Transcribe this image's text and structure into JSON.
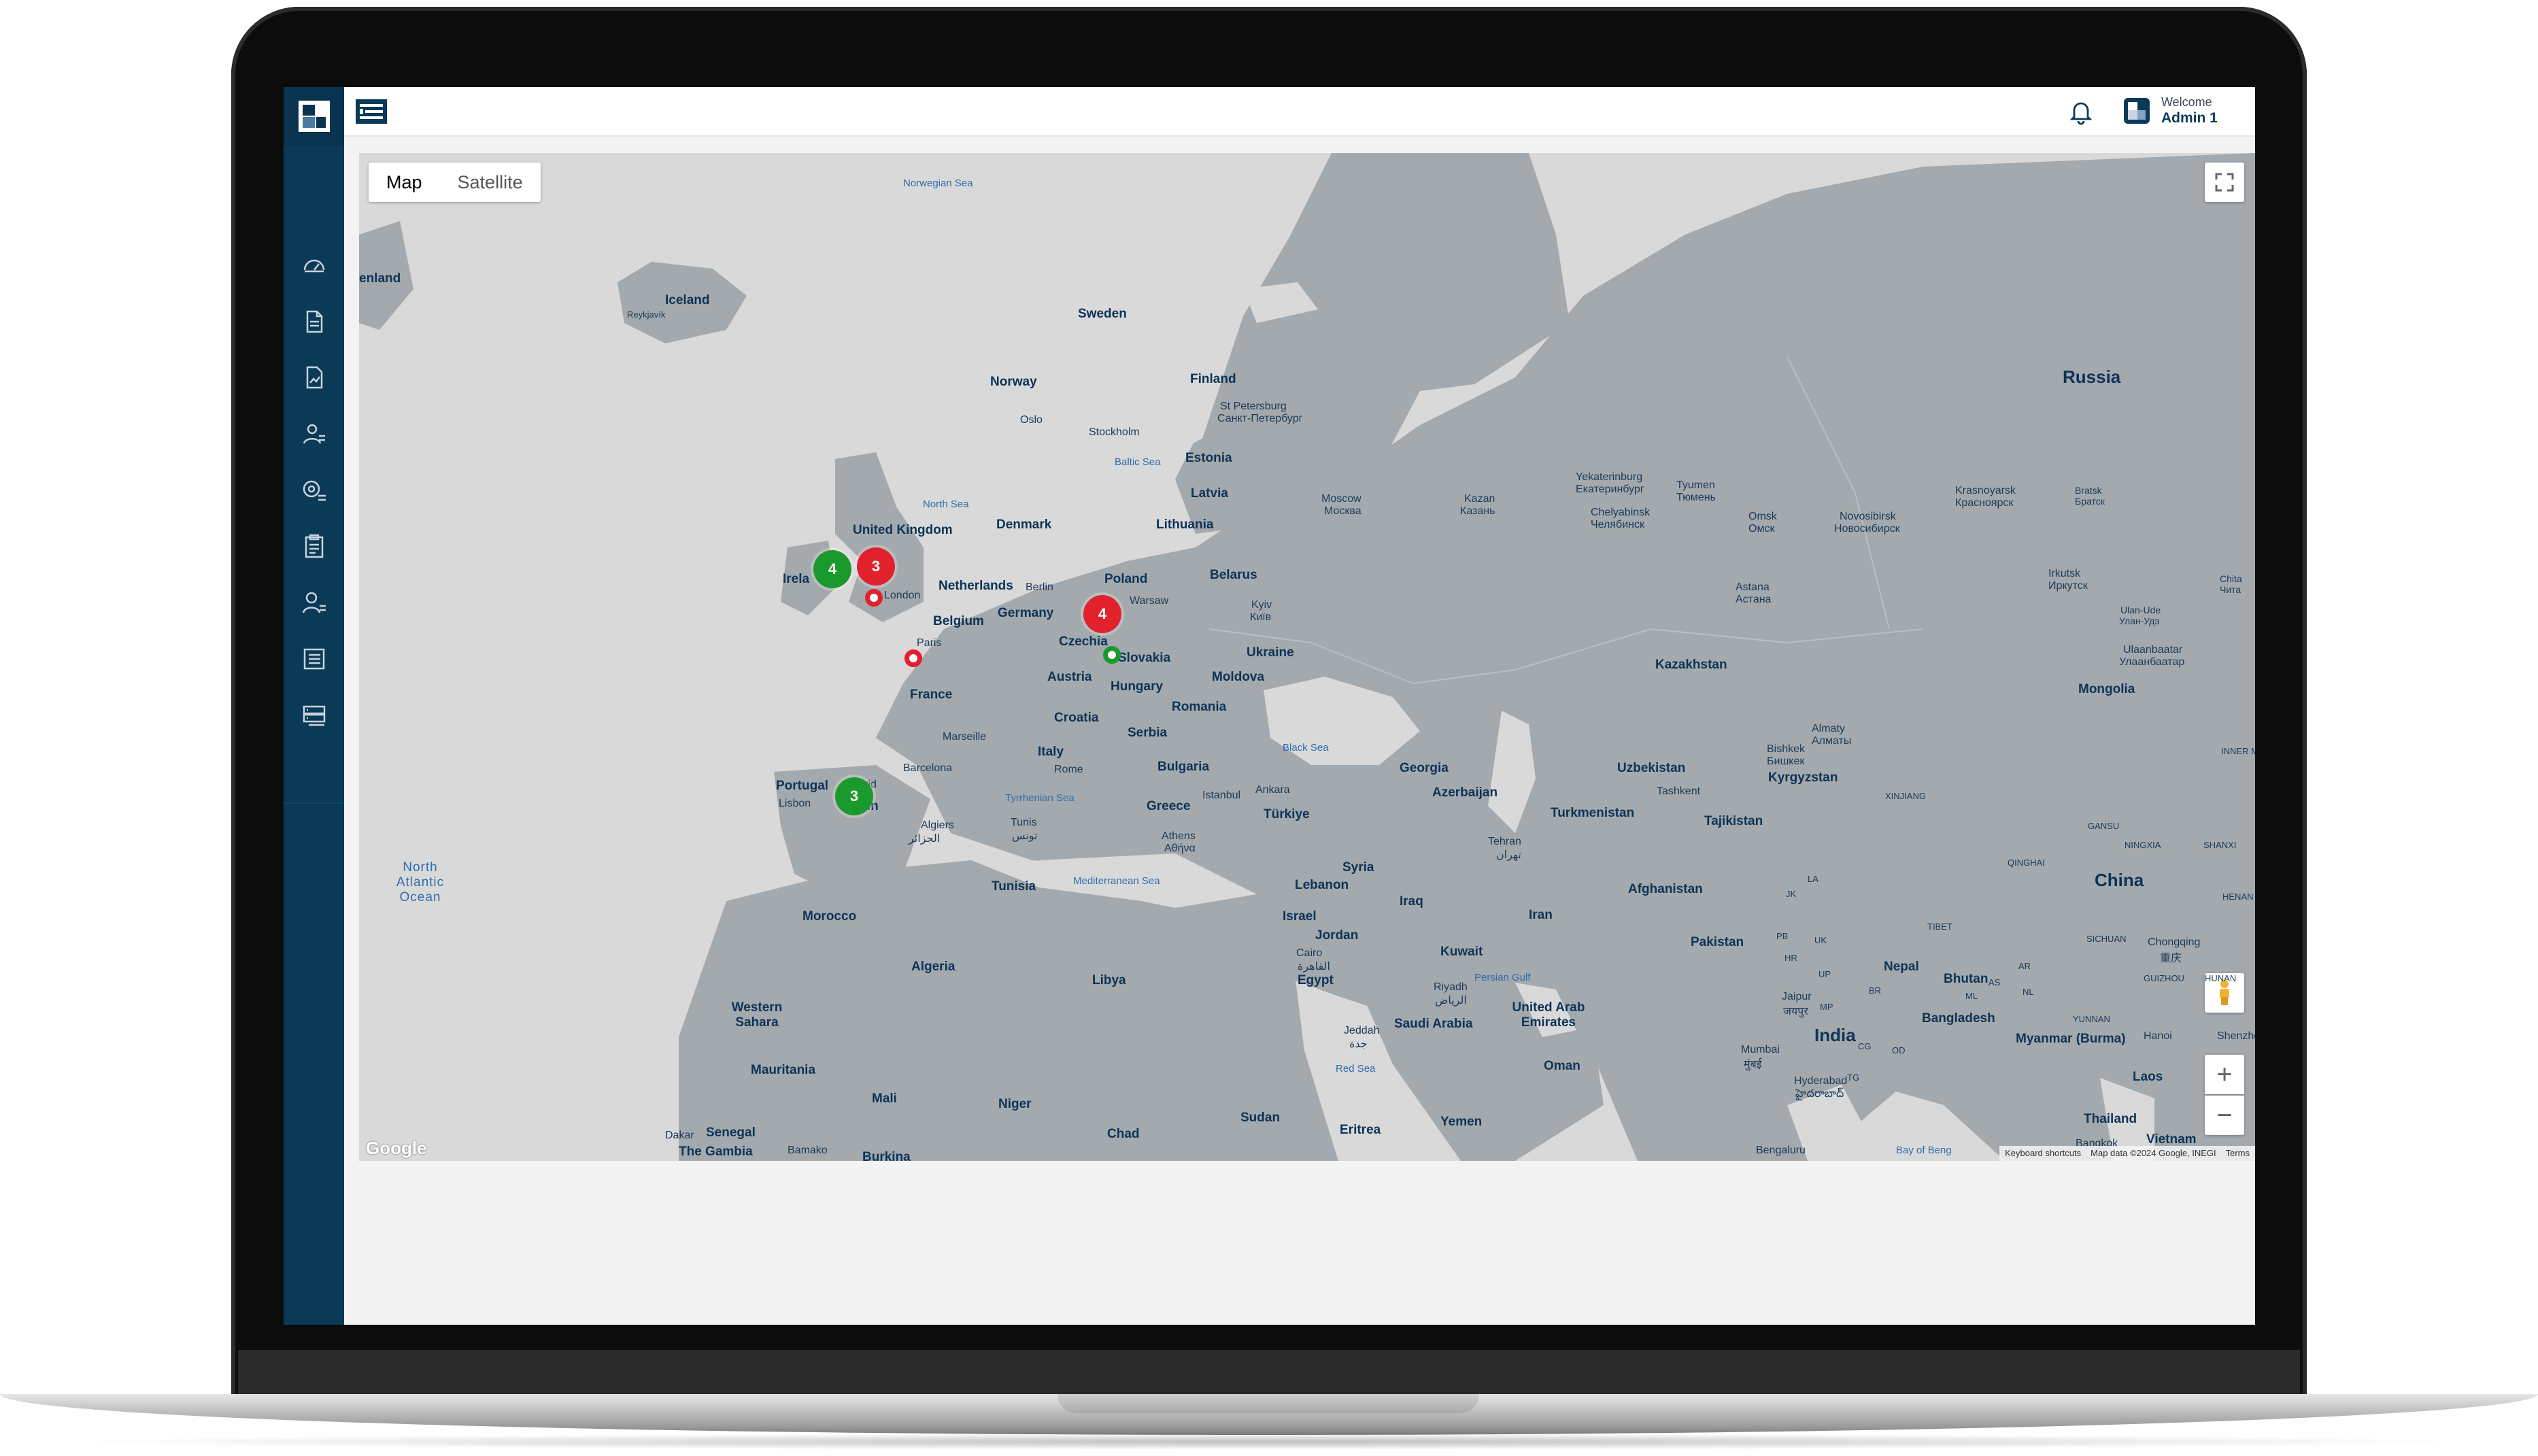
{
  "app": {
    "welcome_label": "Welcome",
    "user_name": "Admin 1",
    "accent_color": "#0b3a57"
  },
  "sidebar": {
    "items": [
      {
        "icon": "dashboard-gauge-icon"
      },
      {
        "icon": "document-icon"
      },
      {
        "icon": "report-chart-icon"
      },
      {
        "icon": "user-location-icon"
      },
      {
        "icon": "location-list-icon"
      },
      {
        "icon": "clipboard-icon"
      },
      {
        "icon": "user-list-icon"
      },
      {
        "icon": "list-icon"
      },
      {
        "icon": "server-list-icon"
      }
    ]
  },
  "map": {
    "type_buttons": [
      "Map",
      "Satellite"
    ],
    "active_type": "Map",
    "google_logo": "Google",
    "attribution": [
      "Keyboard shortcuts",
      "Map data ©2024 Google, INEGI",
      "Terms"
    ],
    "zoom_in": "+",
    "zoom_out": "−",
    "clusters": [
      {
        "count": "4",
        "color": "green",
        "place": "Ireland"
      },
      {
        "count": "3",
        "color": "red",
        "place": "United Kingdom"
      },
      {
        "count": "4",
        "color": "red",
        "place": "Poland"
      },
      {
        "count": "3",
        "color": "green",
        "place": "Spain"
      }
    ],
    "pins": [
      {
        "color": "red",
        "place": "London"
      },
      {
        "color": "red",
        "place": "Paris"
      },
      {
        "color": "green",
        "place": "Slovakia"
      }
    ],
    "labels": {
      "norwegian_sea": "Norwegian Sea",
      "greenland": "enland",
      "iceland": "Iceland",
      "reykjavik": "Reykjavík",
      "sweden": "Sweden",
      "norway": "Norway",
      "finland": "Finland",
      "st_petersburg": "St Petersburg",
      "st_petersburg_local": "Санкт-Петербург",
      "oslo": "Oslo",
      "stockholm": "Stockholm",
      "baltic_sea": "Baltic Sea",
      "estonia": "Estonia",
      "latvia": "Latvia",
      "north_sea": "North Sea",
      "denmark": "Denmark",
      "lithuania": "Lithuania",
      "russia": "Russia",
      "moscow": "Moscow",
      "moscow_local": "Москва",
      "kazan": "Kazan",
      "kazan_local": "Казань",
      "yekaterinburg": "Yekaterinburg",
      "yekaterinburg_local": "Екатеринбург",
      "tyumen": "Tyumen",
      "tyumen_local": "Тюмень",
      "chelyabinsk": "Chelyabinsk",
      "chelyabinsk_local": "Челябинск",
      "omsk": "Omsk",
      "omsk_local": "Омск",
      "novosibirsk": "Novosibirsk",
      "novosibirsk_local": "Новосибирск",
      "krasnoyarsk": "Krasnoyarsk",
      "krasnoyarsk_local": "Красноярск",
      "bratsk": "Bratsk",
      "bratsk_local": "Братск",
      "united_kingdom": "United Kingdom",
      "ireland": "Irela",
      "london": "London",
      "netherlands": "Netherlands",
      "berlin": "Berlin",
      "poland": "Poland",
      "warsaw": "Warsaw",
      "belarus": "Belarus",
      "germany": "Germany",
      "belgium": "Belgium",
      "paris": "Paris",
      "czechia": "Czechia",
      "slovakia": "Slovakia",
      "kyiv": "Kyiv",
      "kyiv_local": "Київ",
      "ukraine": "Ukraine",
      "austria": "Austria",
      "hungary": "Hungary",
      "moldova": "Moldova",
      "france": "France",
      "croatia": "Croatia",
      "romania": "Romania",
      "serbia": "Serbia",
      "marseille": "Marseille",
      "italy": "Italy",
      "black_sea": "Black Sea",
      "bulgaria": "Bulgaria",
      "barcelona": "Barcelona",
      "rome": "Rome",
      "portugal": "Portugal",
      "madrid": "Madrid",
      "spain": "Spain",
      "lisbon": "Lisbon",
      "tyrrhenian_sea": "Tyrrhenian Sea",
      "istanbul": "Istanbul",
      "ankara": "Ankara",
      "greece": "Greece",
      "turkiye": "Türkiye",
      "georgia": "Georgia",
      "azerbaijan": "Azerbaijan",
      "algiers": "Algiers",
      "algiers_local": "الجزائر",
      "tunis": "Tunis",
      "tunis_local": "تونس",
      "athens": "Athens",
      "athens_local": "Αθήνα",
      "north_atlantic_ocean": "North Atlantic Ocean",
      "tunisia": "Tunisia",
      "mediterranean_sea": "Mediterranean Sea",
      "syria": "Syria",
      "lebanon": "Lebanon",
      "iraq": "Iraq",
      "tehran": "Tehran",
      "tehran_local": "تهران",
      "iran": "Iran",
      "morocco": "Morocco",
      "israel": "Israel",
      "jordan": "Jordan",
      "kuwait": "Kuwait",
      "algeria": "Algeria",
      "libya": "Libya",
      "cairo": "Cairo",
      "cairo_local": "القاهرة",
      "egypt": "Egypt",
      "persian_gulf": "Persian Gulf",
      "riyadh": "Riyadh",
      "riyadh_local": "الرياض",
      "saudi_arabia": "Saudi Arabia",
      "uae": "United Arab Emirates",
      "western_sahara": "Western Sahara",
      "jeddah": "Jeddah",
      "jeddah_local": "جدة",
      "mauritania": "Mauritania",
      "red_sea": "Red Sea",
      "oman": "Oman",
      "mali": "Mali",
      "niger": "Niger",
      "sudan": "Sudan",
      "chad": "Chad",
      "eritrea": "Eritrea",
      "yemen": "Yemen",
      "dakar": "Dakar",
      "senegal": "Senegal",
      "the_gambia": "The Gambia",
      "bamako": "Bamako",
      "burkina": "Burkina",
      "kazakhstan": "Kazakhstan",
      "astana": "Astana",
      "astana_local": "Астана",
      "uzbekistan": "Uzbekistan",
      "bishkek": "Bishkek",
      "bishkek_local": "Бишкек",
      "almaty": "Almaty",
      "almaty_local": "Алматы",
      "tashkent": "Tashkent",
      "kyrgyzstan": "Kyrgyzstan",
      "turkmenistan": "Turkmenistan",
      "tajikistan": "Tajikistan",
      "afghanistan": "Afghanistan",
      "pakistan": "Pakistan",
      "irkutsk": "Irkutsk",
      "irkutsk_local": "Иркутск",
      "chita": "Chita",
      "chita_local": "Чита",
      "ulan_ude": "Ulan-Ude",
      "ulan_ude_local": "Улан-Удэ",
      "ulaanbaatar": "Ulaanbaatar",
      "ulaanbaatar_local": "Улаанбаатар",
      "mongolia": "Mongolia",
      "inner_mongolia": "INNER MONGO",
      "xinjiang": "XINJIANG",
      "gansu": "GANSU",
      "ningxia": "NINGXIA",
      "shanxi": "SHANXI",
      "qinghai": "QINGHAI",
      "china": "China",
      "henan": "HENAN",
      "tibet": "TIBET",
      "sichuan": "SICHUAN",
      "chongqing": "Chongqing",
      "chongqing_local": "重庆",
      "nepal": "Nepal",
      "bhutan": "Bhutan",
      "guizhou": "GUIZHOU",
      "hunan": "HUNAN",
      "jaipur": "Jaipur",
      "jaipur_local": "जयपुर",
      "india": "India",
      "bangladesh": "Bangladesh",
      "yunnan": "YUNNAN",
      "myanmar": "Myanmar (Burma)",
      "hanoi": "Hanoi",
      "shenzhen": "Shenzhe",
      "mumbai": "Mumbai",
      "mumbai_local": "मुंबई",
      "hyderabad": "Hyderabad",
      "hyderabad_local": "హైదరాబాద్",
      "laos": "Laos",
      "thailand": "Thailand",
      "bengaluru": "Bengaluru",
      "bay_of_bengal": "Bay of Beng",
      "bangkok": "Bangkok",
      "vietnam": "Vietnam",
      "jk": "JK",
      "la": "LA",
      "pb": "PB",
      "hr": "HR",
      "uk": "UK",
      "up": "UP",
      "mp": "MP",
      "br": "BR",
      "ar": "AR",
      "nl": "NL",
      "as": "AS",
      "ml": "ML",
      "tg": "TG",
      "cg": "CG",
      "od": "OD"
    }
  }
}
